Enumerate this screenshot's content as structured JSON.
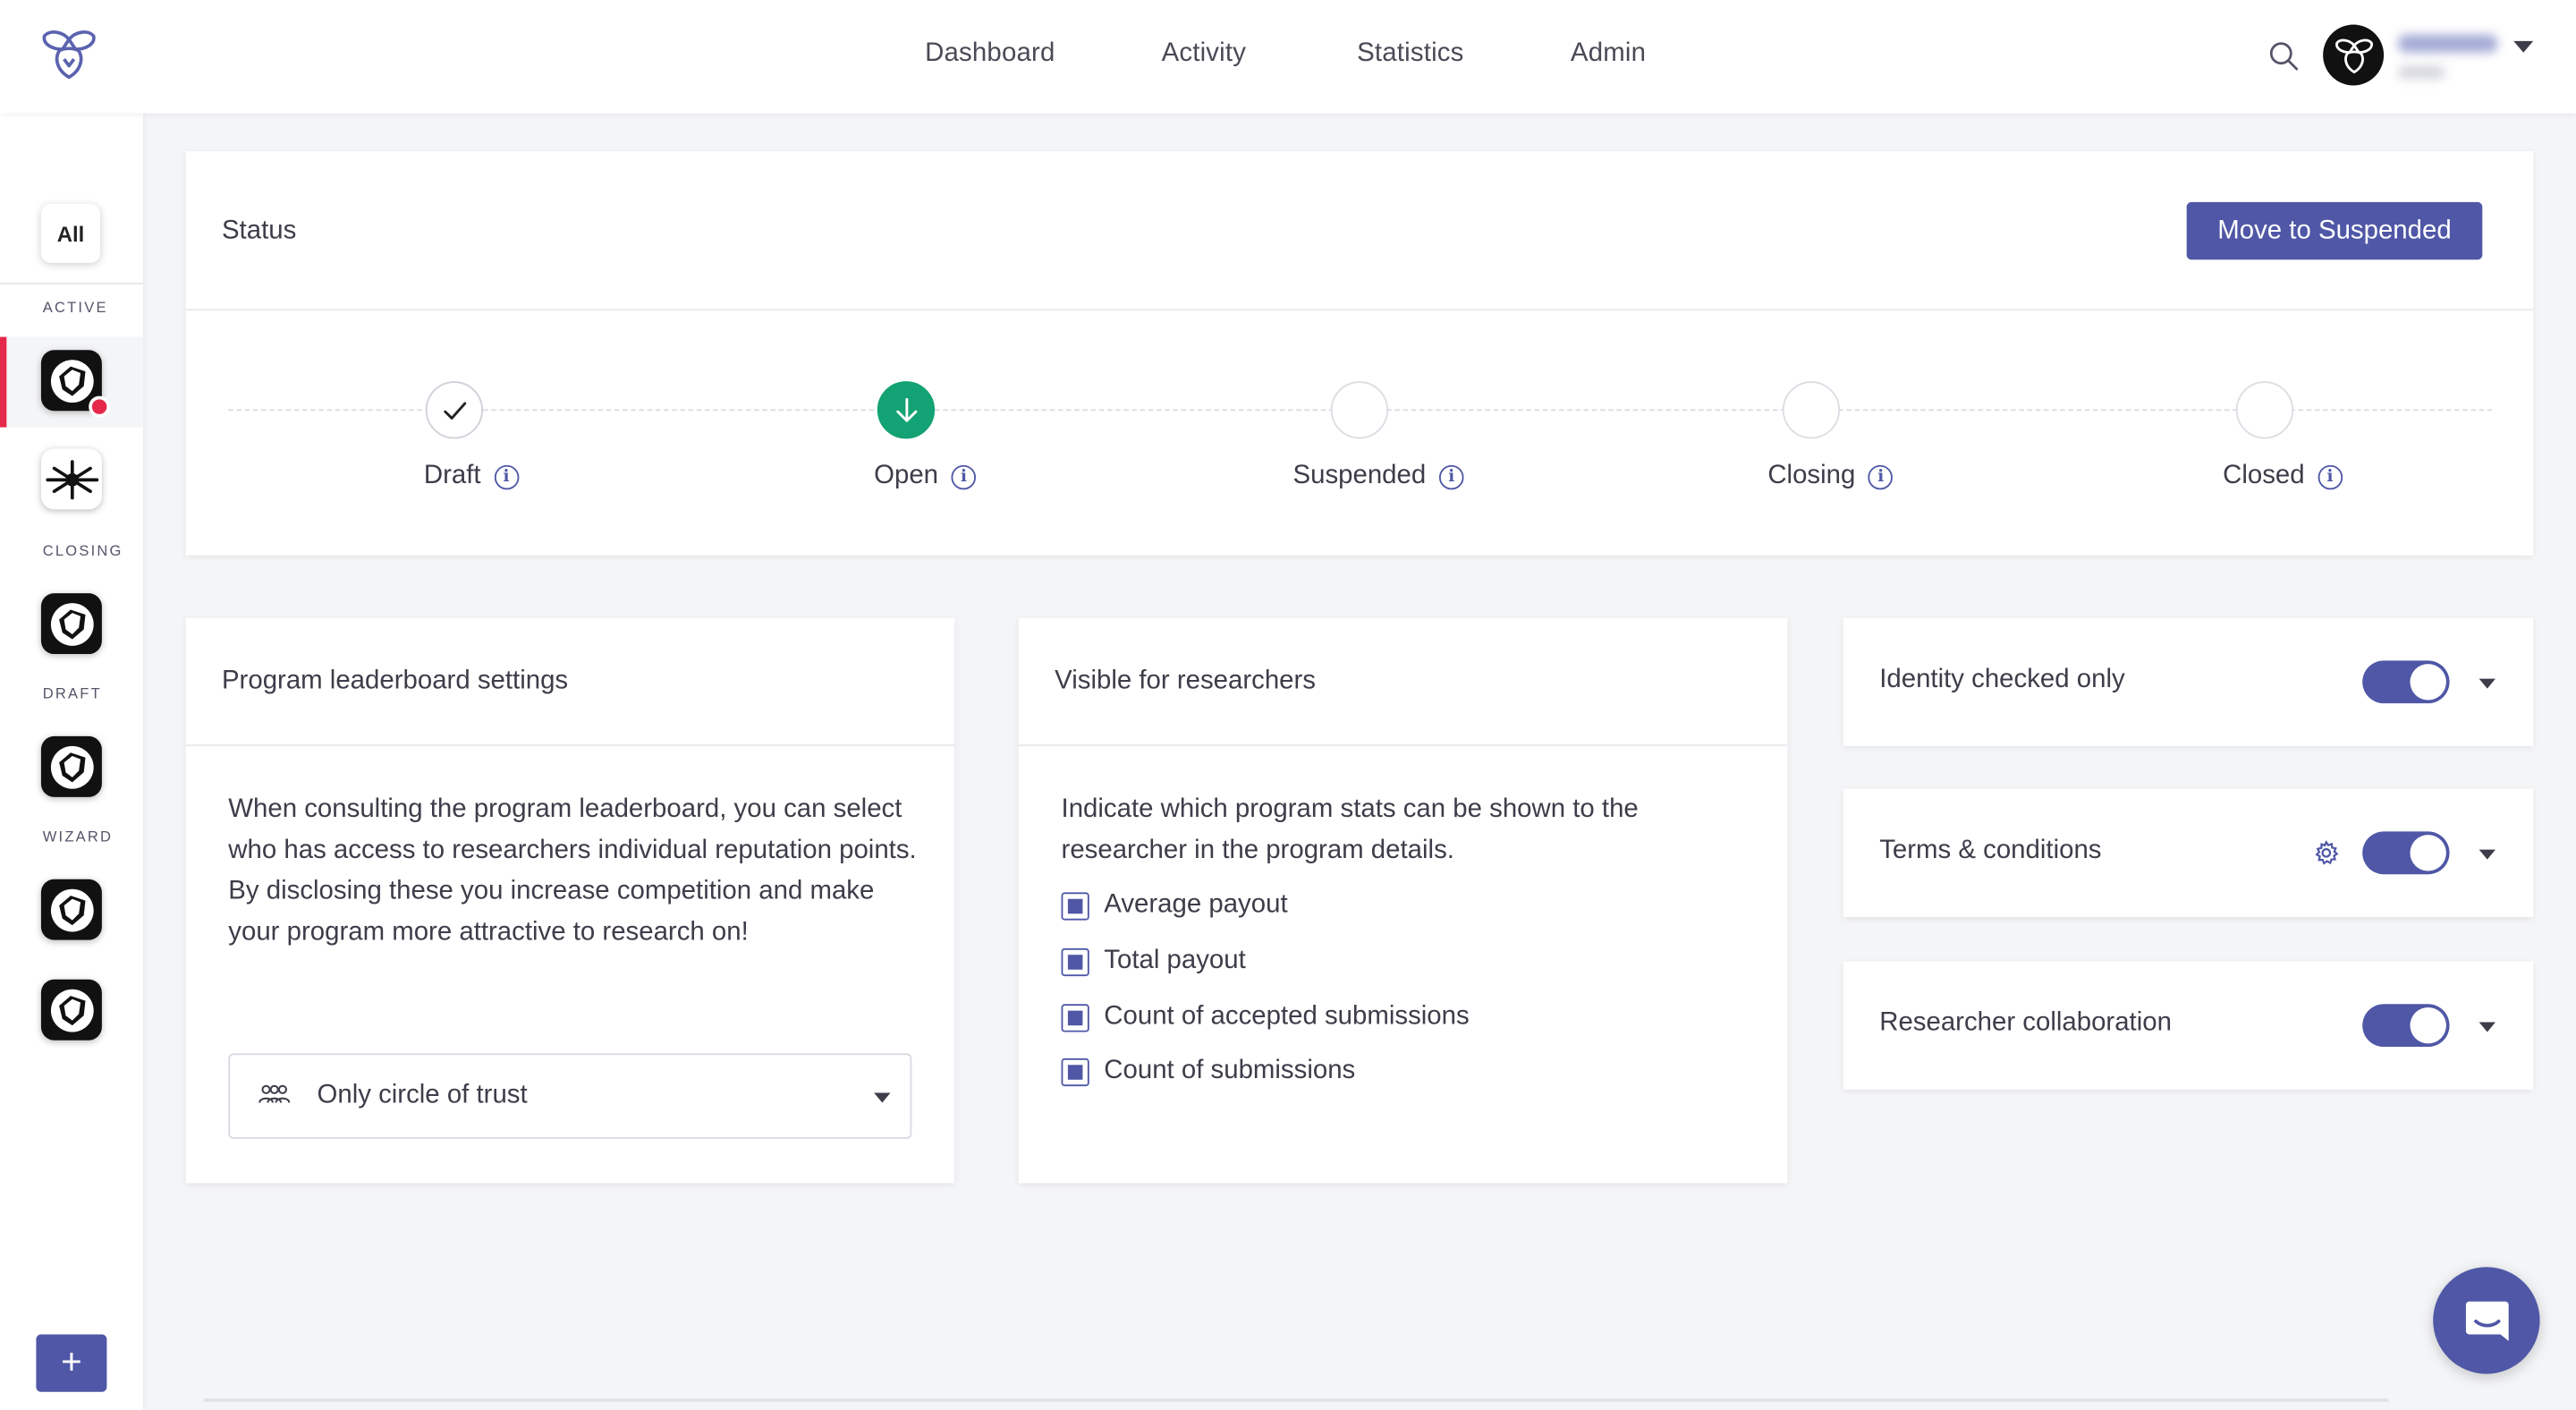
{
  "header": {
    "nav": [
      "Dashboard",
      "Activity",
      "Statistics",
      "Admin"
    ]
  },
  "sidebar": {
    "all_label": "All",
    "sections": [
      "ACTIVE",
      "CLOSING",
      "DRAFT",
      "WIZARD"
    ],
    "add_label": "+"
  },
  "status": {
    "title": "Status",
    "action_label": "Move to Suspended",
    "steps": [
      {
        "label": "Draft",
        "state": "done"
      },
      {
        "label": "Open",
        "state": "current"
      },
      {
        "label": "Suspended",
        "state": "pending"
      },
      {
        "label": "Closing",
        "state": "pending"
      },
      {
        "label": "Closed",
        "state": "pending"
      }
    ]
  },
  "leaderboard": {
    "title": "Program leaderboard settings",
    "description": "When consulting the program leaderboard, you can select who has access to researchers individual reputation points. By disclosing these you increase competition and make your program more attractive to research on!",
    "select_value": "Only circle of trust"
  },
  "visible": {
    "title": "Visible for researchers",
    "description": "Indicate which program stats can be shown to the researcher in the program details.",
    "options": [
      {
        "label": "Average payout",
        "checked": true
      },
      {
        "label": "Total payout",
        "checked": true
      },
      {
        "label": "Count of accepted submissions",
        "checked": true
      },
      {
        "label": "Count of submissions",
        "checked": true
      }
    ]
  },
  "toggles": [
    {
      "label": "Identity checked only",
      "on": true,
      "gear": false
    },
    {
      "label": "Terms & conditions",
      "on": true,
      "gear": true
    },
    {
      "label": "Researcher collaboration",
      "on": true,
      "gear": false
    }
  ],
  "colors": {
    "accent": "#4f57a6",
    "success": "#13a273",
    "alert": "#e5294a"
  }
}
